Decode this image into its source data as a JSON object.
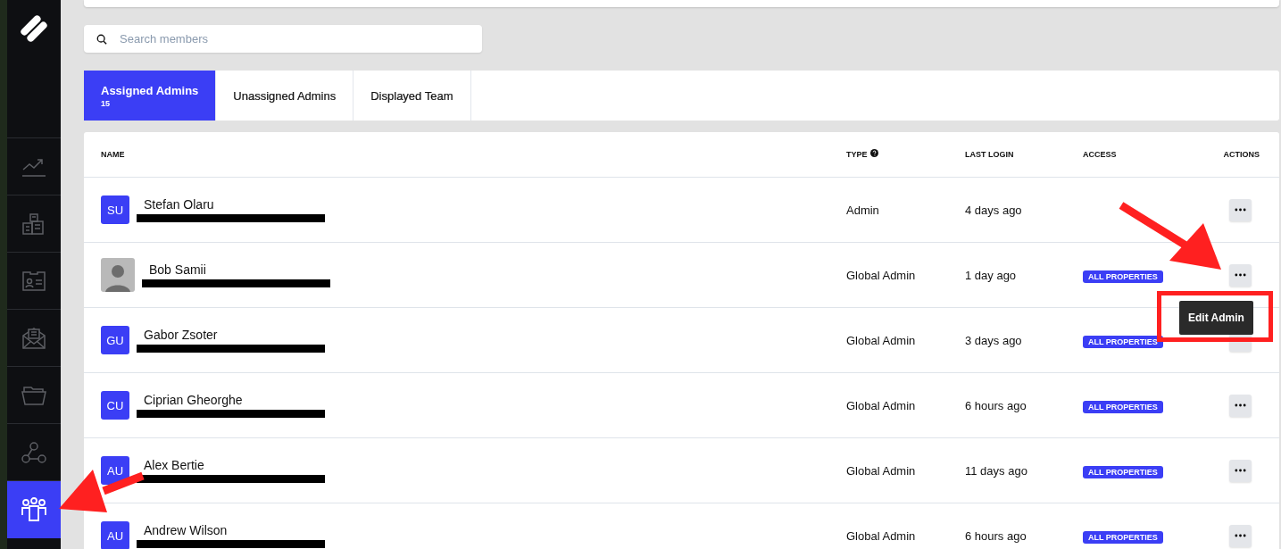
{
  "sidebar": {
    "items": [
      {
        "selected": false
      },
      {
        "selected": false
      },
      {
        "selected": false
      },
      {
        "selected": false
      },
      {
        "selected": false
      },
      {
        "selected": false
      },
      {
        "selected": true
      }
    ]
  },
  "search": {
    "placeholder": "Search members"
  },
  "tabs": [
    {
      "label": "Assigned Admins",
      "count": "15",
      "selected": true
    },
    {
      "label": "Unassigned Admins",
      "selected": false
    },
    {
      "label": "Displayed Team",
      "selected": false
    }
  ],
  "table": {
    "columns": [
      "NAME",
      "TYPE",
      "LAST LOGIN",
      "ACCESS",
      "ACTIONS"
    ],
    "rows": [
      {
        "initials": "SU",
        "kind": "initials",
        "name": "Stefan Olaru",
        "type": "Admin",
        "last_login": "4 days ago"
      },
      {
        "kind": "photo",
        "name": "Bob Samii",
        "type": "Global Admin",
        "last_login": "1 day ago",
        "access": "ALL PROPERTIES"
      },
      {
        "initials": "GU",
        "kind": "initials",
        "name": "Gabor Zsoter",
        "type": "Global Admin",
        "last_login": "3 days ago",
        "access": "ALL PROPERTIES"
      },
      {
        "initials": "CU",
        "kind": "initials",
        "name": "Ciprian Gheorghe",
        "type": "Global Admin",
        "last_login": "6 hours ago",
        "access": "ALL PROPERTIES"
      },
      {
        "initials": "AU",
        "kind": "initials",
        "name": "Alex Bertie",
        "type": "Global Admin",
        "last_login": "11 days ago",
        "access": "ALL PROPERTIES"
      },
      {
        "initials": "AU",
        "kind": "initials",
        "name": "Andrew Wilson",
        "type": "Global Admin",
        "last_login": "6 hours ago",
        "access": "ALL PROPERTIES"
      }
    ]
  },
  "tooltip": {
    "label": "Edit Admin"
  }
}
